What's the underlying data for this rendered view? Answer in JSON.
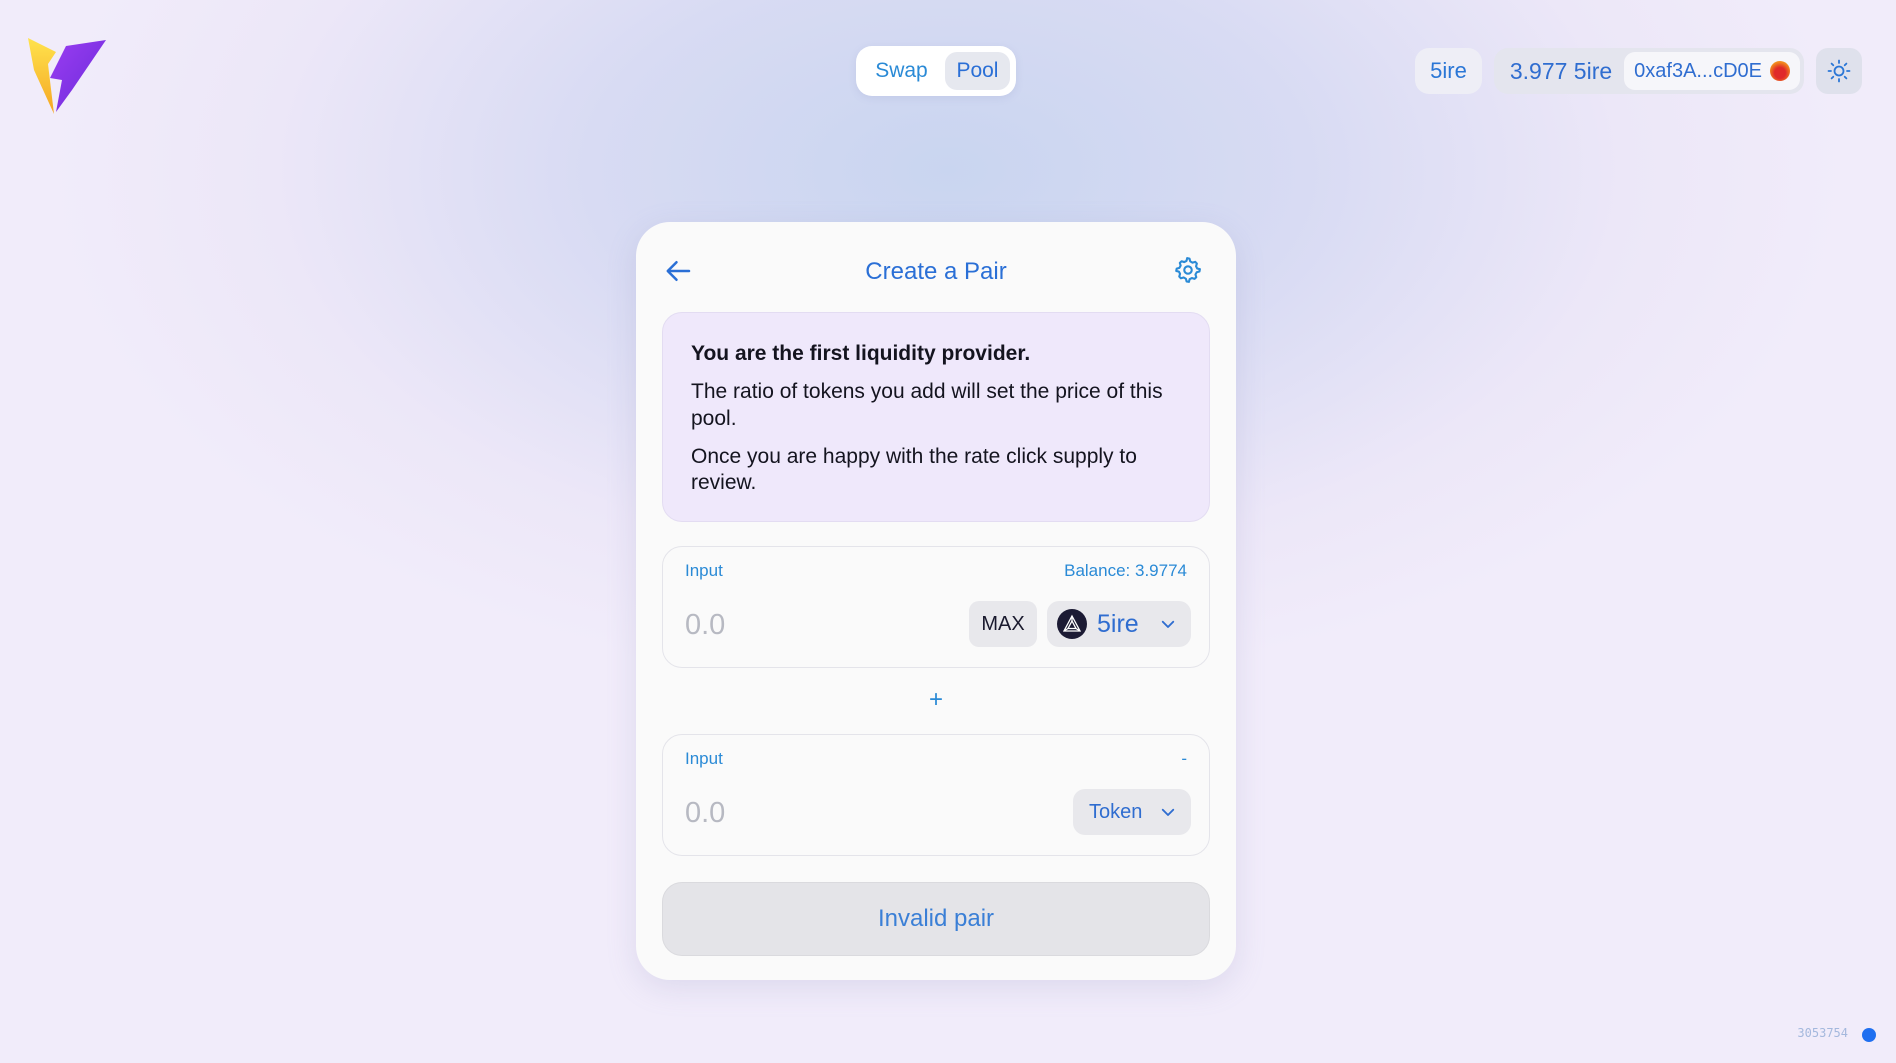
{
  "nav": {
    "swap_label": "Swap",
    "pool_label": "Pool"
  },
  "header": {
    "network_label": "5ire",
    "wallet_balance": "3.977 5ire",
    "wallet_address": "0xaf3A...cD0E"
  },
  "card": {
    "title": "Create a Pair",
    "notice": {
      "title": "You are the first liquidity provider.",
      "paragraph1": "The ratio of tokens you add will set the price of this pool.",
      "paragraph2": "Once you are happy with the rate click supply to review."
    },
    "input_a": {
      "label": "Input",
      "balance": "Balance: 3.9774",
      "placeholder": "0.0",
      "max_label": "MAX",
      "token": "5ire"
    },
    "plus": "+",
    "input_b": {
      "label": "Input",
      "balance": "-",
      "placeholder": "0.0",
      "token": "Token"
    },
    "submit_label": "Invalid pair"
  },
  "footer": {
    "block_number": "3053754"
  },
  "colors": {
    "accent": "#2a6fd6",
    "status": "#1f6ff0"
  },
  "icons": [
    "logo-icon",
    "back-arrow-icon",
    "gear-icon",
    "sun-icon",
    "chevron-down-icon",
    "token-5ire-icon"
  ]
}
